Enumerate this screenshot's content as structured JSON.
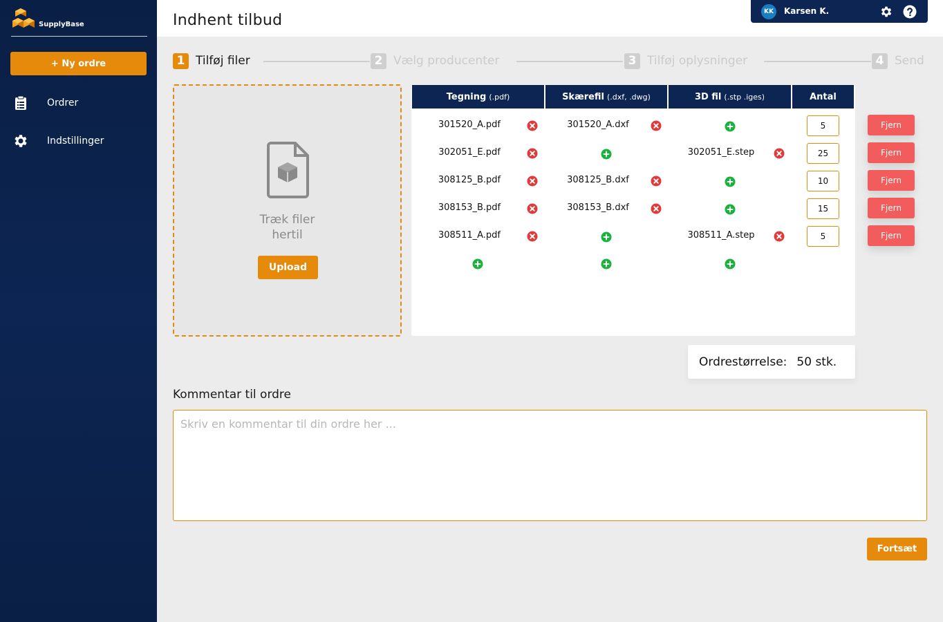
{
  "app": {
    "name": "SupplyBase"
  },
  "sidebar": {
    "new_order_label": "+ Ny ordre",
    "items": [
      {
        "label": "Ordrer",
        "icon": "clipboard-icon"
      },
      {
        "label": "Indstillinger",
        "icon": "gear-icon"
      }
    ]
  },
  "header": {
    "title": "Indhent tilbud",
    "user": {
      "initials": "KK",
      "name": "Karsen K."
    }
  },
  "steps": [
    {
      "num": "1",
      "label": "Tilføj filer",
      "active": true
    },
    {
      "num": "2",
      "label": "Vælg producenter",
      "active": false
    },
    {
      "num": "3",
      "label": "Tilføj oplysninger",
      "active": false
    },
    {
      "num": "4",
      "label": "Send",
      "active": false
    }
  ],
  "dropzone": {
    "text_line1": "Træk filer",
    "text_line2": "hertil",
    "upload_label": "Upload"
  },
  "table": {
    "columns": [
      {
        "name": "Tegning",
        "ext": "(.pdf)"
      },
      {
        "name": "Skærefil",
        "ext": "(.dxf, .dwg)"
      },
      {
        "name": "3D fil",
        "ext": "(.stp .iges)"
      },
      {
        "name": "Antal",
        "ext": ""
      }
    ],
    "rows": [
      {
        "drawing": "301520_A.pdf",
        "cutfile": "301520_A.dxf",
        "model3d": "",
        "qty": "5"
      },
      {
        "drawing": "302051_E.pdf",
        "cutfile": "",
        "model3d": "302051_E.step",
        "qty": "25"
      },
      {
        "drawing": "308125_B.pdf",
        "cutfile": "308125_B.dxf",
        "model3d": "",
        "qty": "10"
      },
      {
        "drawing": "308153_B.pdf",
        "cutfile": "308153_B.dxf",
        "model3d": "",
        "qty": "15"
      },
      {
        "drawing": "308511_A.pdf",
        "cutfile": "",
        "model3d": "308511_A.step",
        "qty": "5"
      }
    ],
    "remove_label": "Fjern"
  },
  "order_size": {
    "label": "Ordrestørrelse:",
    "value": "50 stk."
  },
  "comment": {
    "label": "Kommentar til ordre",
    "placeholder": "Skriv en kommentar til din ordre her ...",
    "value": ""
  },
  "continue_label": "Fortsæt",
  "colors": {
    "accent": "#e68a0c",
    "navy": "#0c2552",
    "danger": "#f25c5c",
    "remove_icon": "#e03a3a",
    "add_icon": "#17b33a"
  }
}
